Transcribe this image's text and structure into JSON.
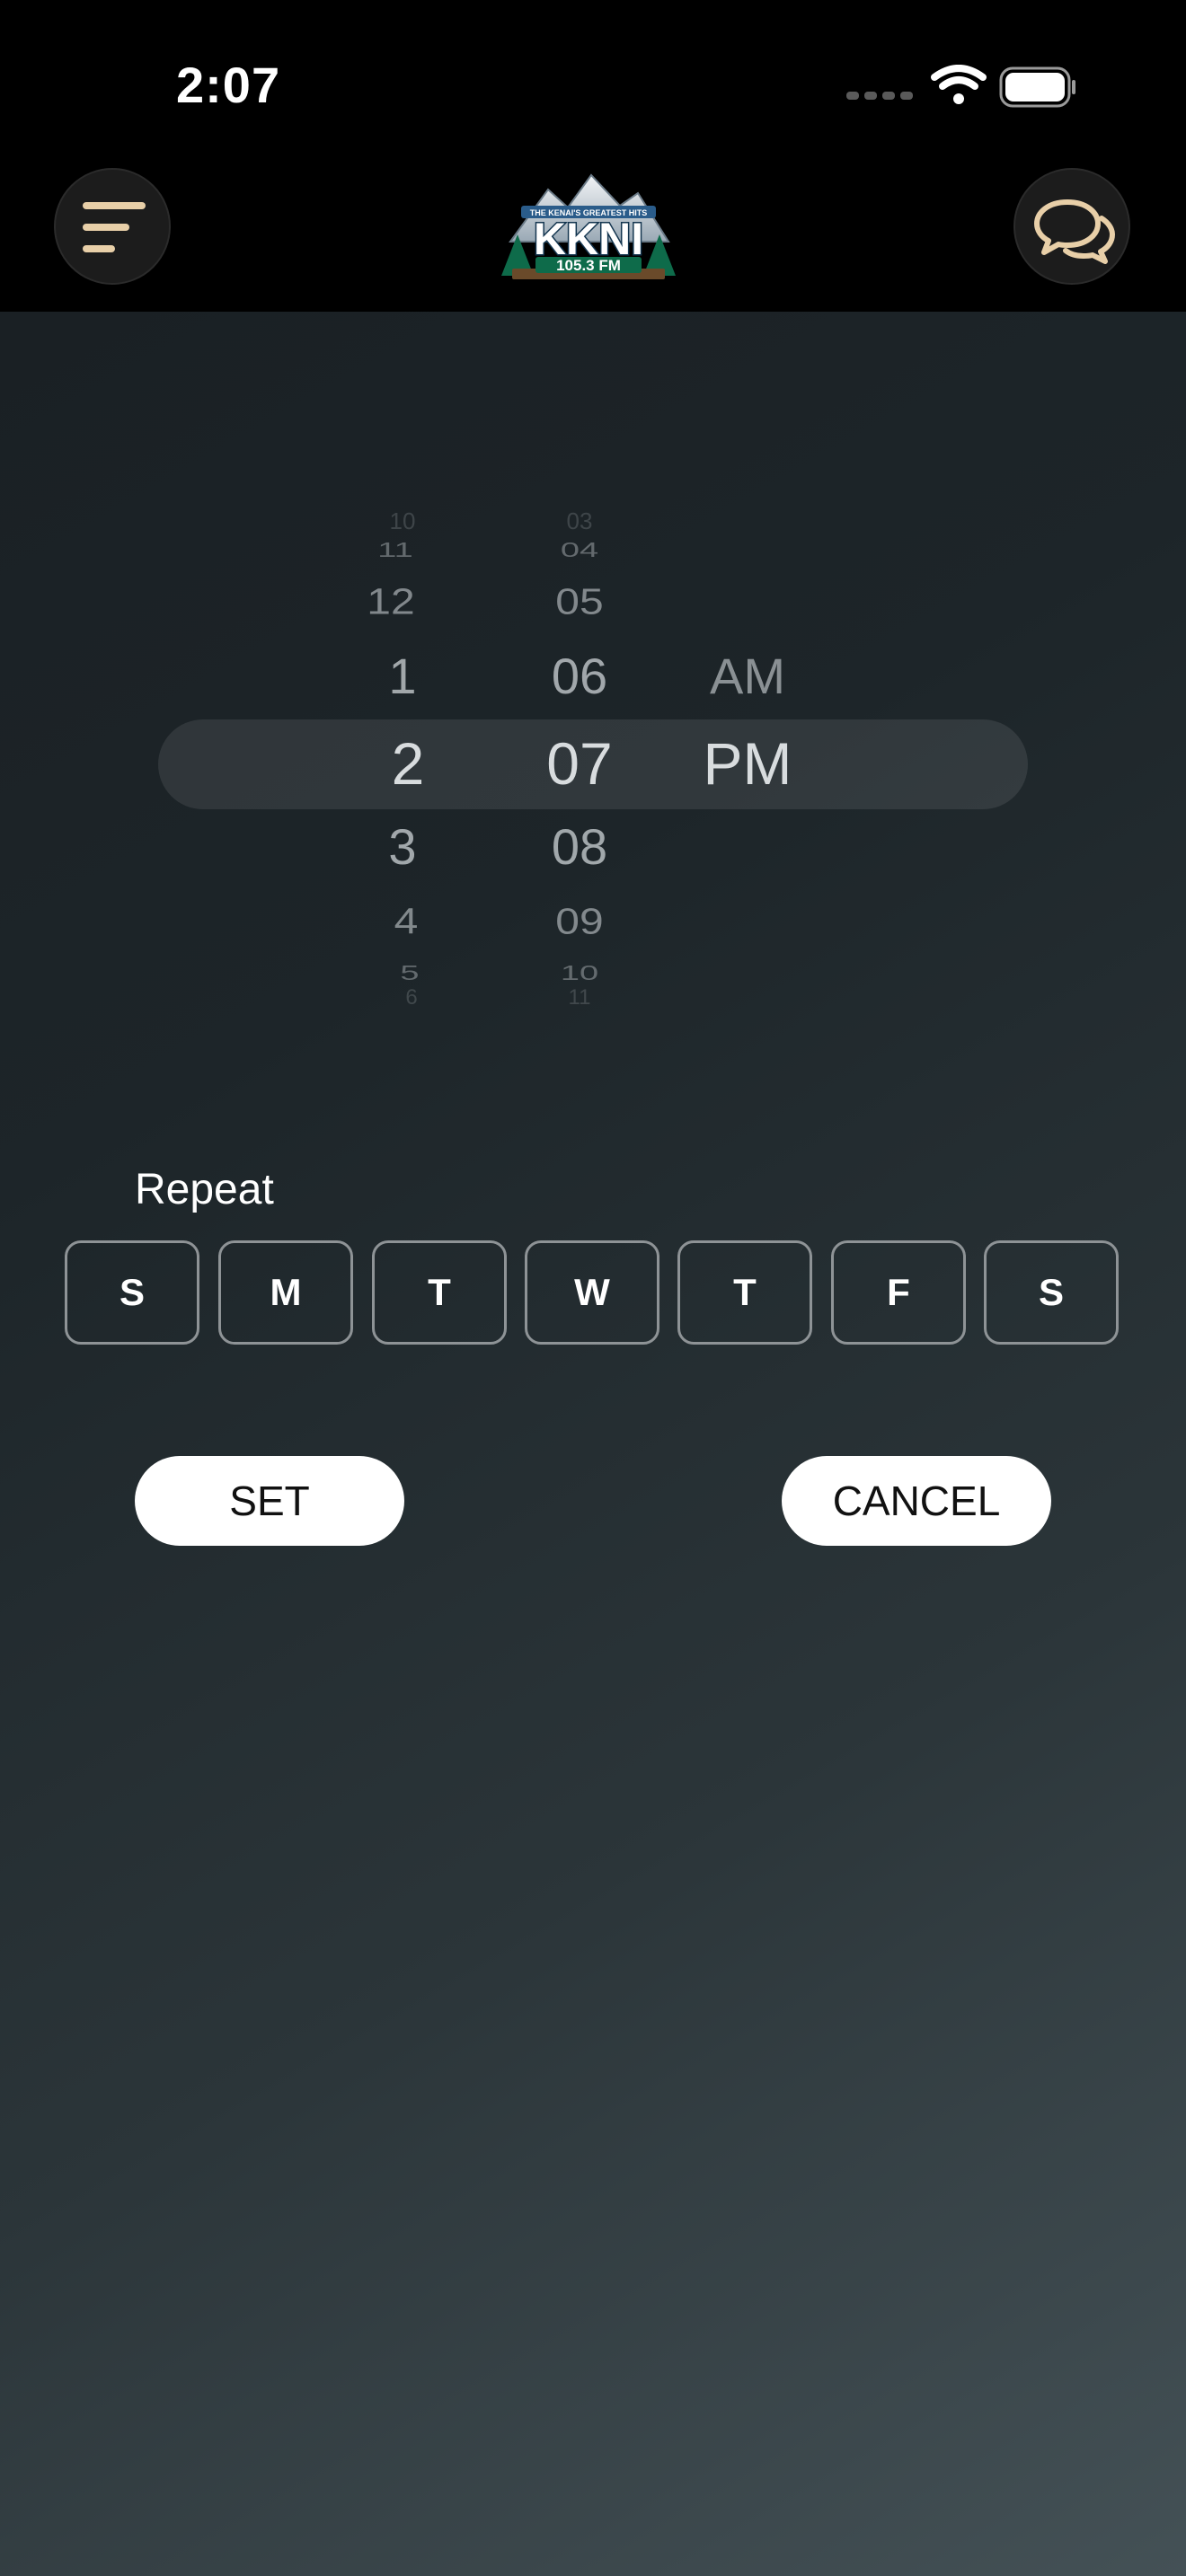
{
  "status_bar": {
    "time": "2:07",
    "icons": [
      "signal-dots-icon",
      "wifi-icon",
      "battery-icon"
    ]
  },
  "header": {
    "menu_icon": "menu-icon",
    "chat_icon": "chat-bubbles-icon",
    "logo": {
      "tagline": "THE KENAI'S GREATEST HITS",
      "name": "KKNI",
      "frequency": "105.3 FM"
    }
  },
  "time_picker": {
    "hours": [
      "10",
      "11",
      "12",
      "1",
      "2",
      "3",
      "4",
      "5",
      "6"
    ],
    "minutes": [
      "03",
      "04",
      "05",
      "06",
      "07",
      "08",
      "09",
      "10",
      "11"
    ],
    "periods": [
      "AM",
      "PM"
    ],
    "selected_hour": "2",
    "selected_minute": "07",
    "selected_period": "PM"
  },
  "repeat": {
    "label": "Repeat",
    "days": [
      "S",
      "M",
      "T",
      "W",
      "T",
      "F",
      "S"
    ]
  },
  "actions": {
    "set_label": "SET",
    "cancel_label": "CANCEL"
  },
  "colors": {
    "logo_green": "#0e6b4a",
    "logo_blue": "#2a5c8a",
    "accent_tan": "#e8cfa8"
  }
}
